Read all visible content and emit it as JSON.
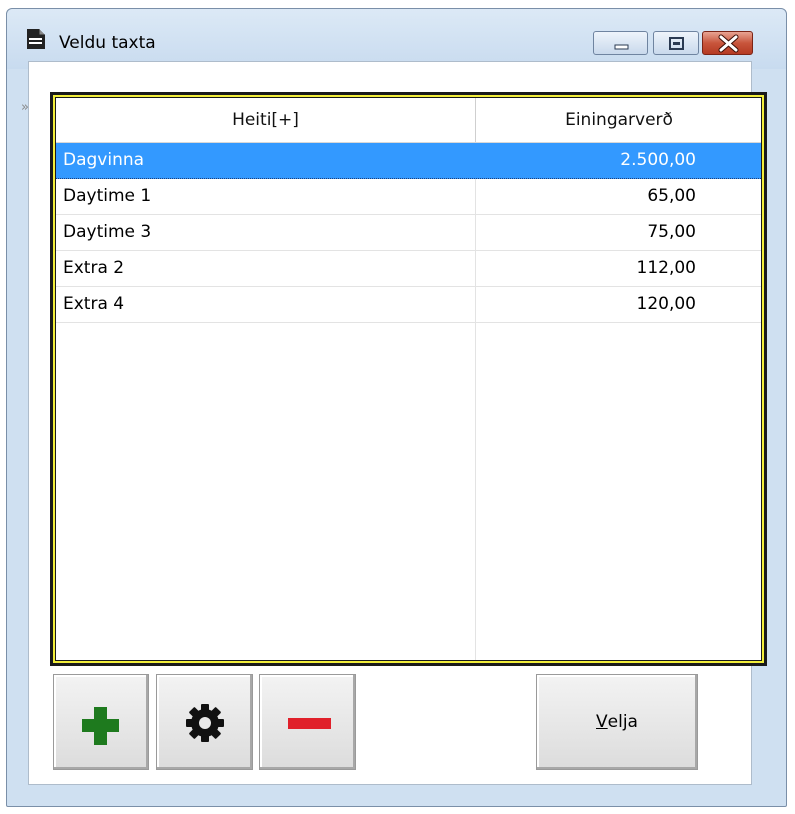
{
  "window": {
    "title": "Veldu taxta",
    "title_icon": "document-icon",
    "controls": [
      "minimize-icon",
      "maximize-icon",
      "close-icon"
    ]
  },
  "grid": {
    "columns": [
      "Heiti[+]",
      "Einingarverð"
    ],
    "rows": [
      {
        "name": "Dagvinna",
        "price": "2.500,00",
        "selected": true
      },
      {
        "name": "Daytime 1",
        "price": "65,00",
        "selected": false
      },
      {
        "name": "Daytime 3",
        "price": "75,00",
        "selected": false
      },
      {
        "name": "Extra 2",
        "price": "112,00",
        "selected": false
      },
      {
        "name": "Extra 4",
        "price": "120,00",
        "selected": false
      }
    ],
    "selection_color": "#3399ff",
    "frame_color": "#f2ee3a"
  },
  "toolbar": {
    "chevron": "»",
    "add_icon": "plus-icon",
    "edit_icon": "gear-icon",
    "remove_icon": "minus-icon",
    "add_color": "#1e7a1e",
    "remove_color": "#e0202a",
    "select_label_first": "V",
    "select_label_rest": "elja"
  }
}
